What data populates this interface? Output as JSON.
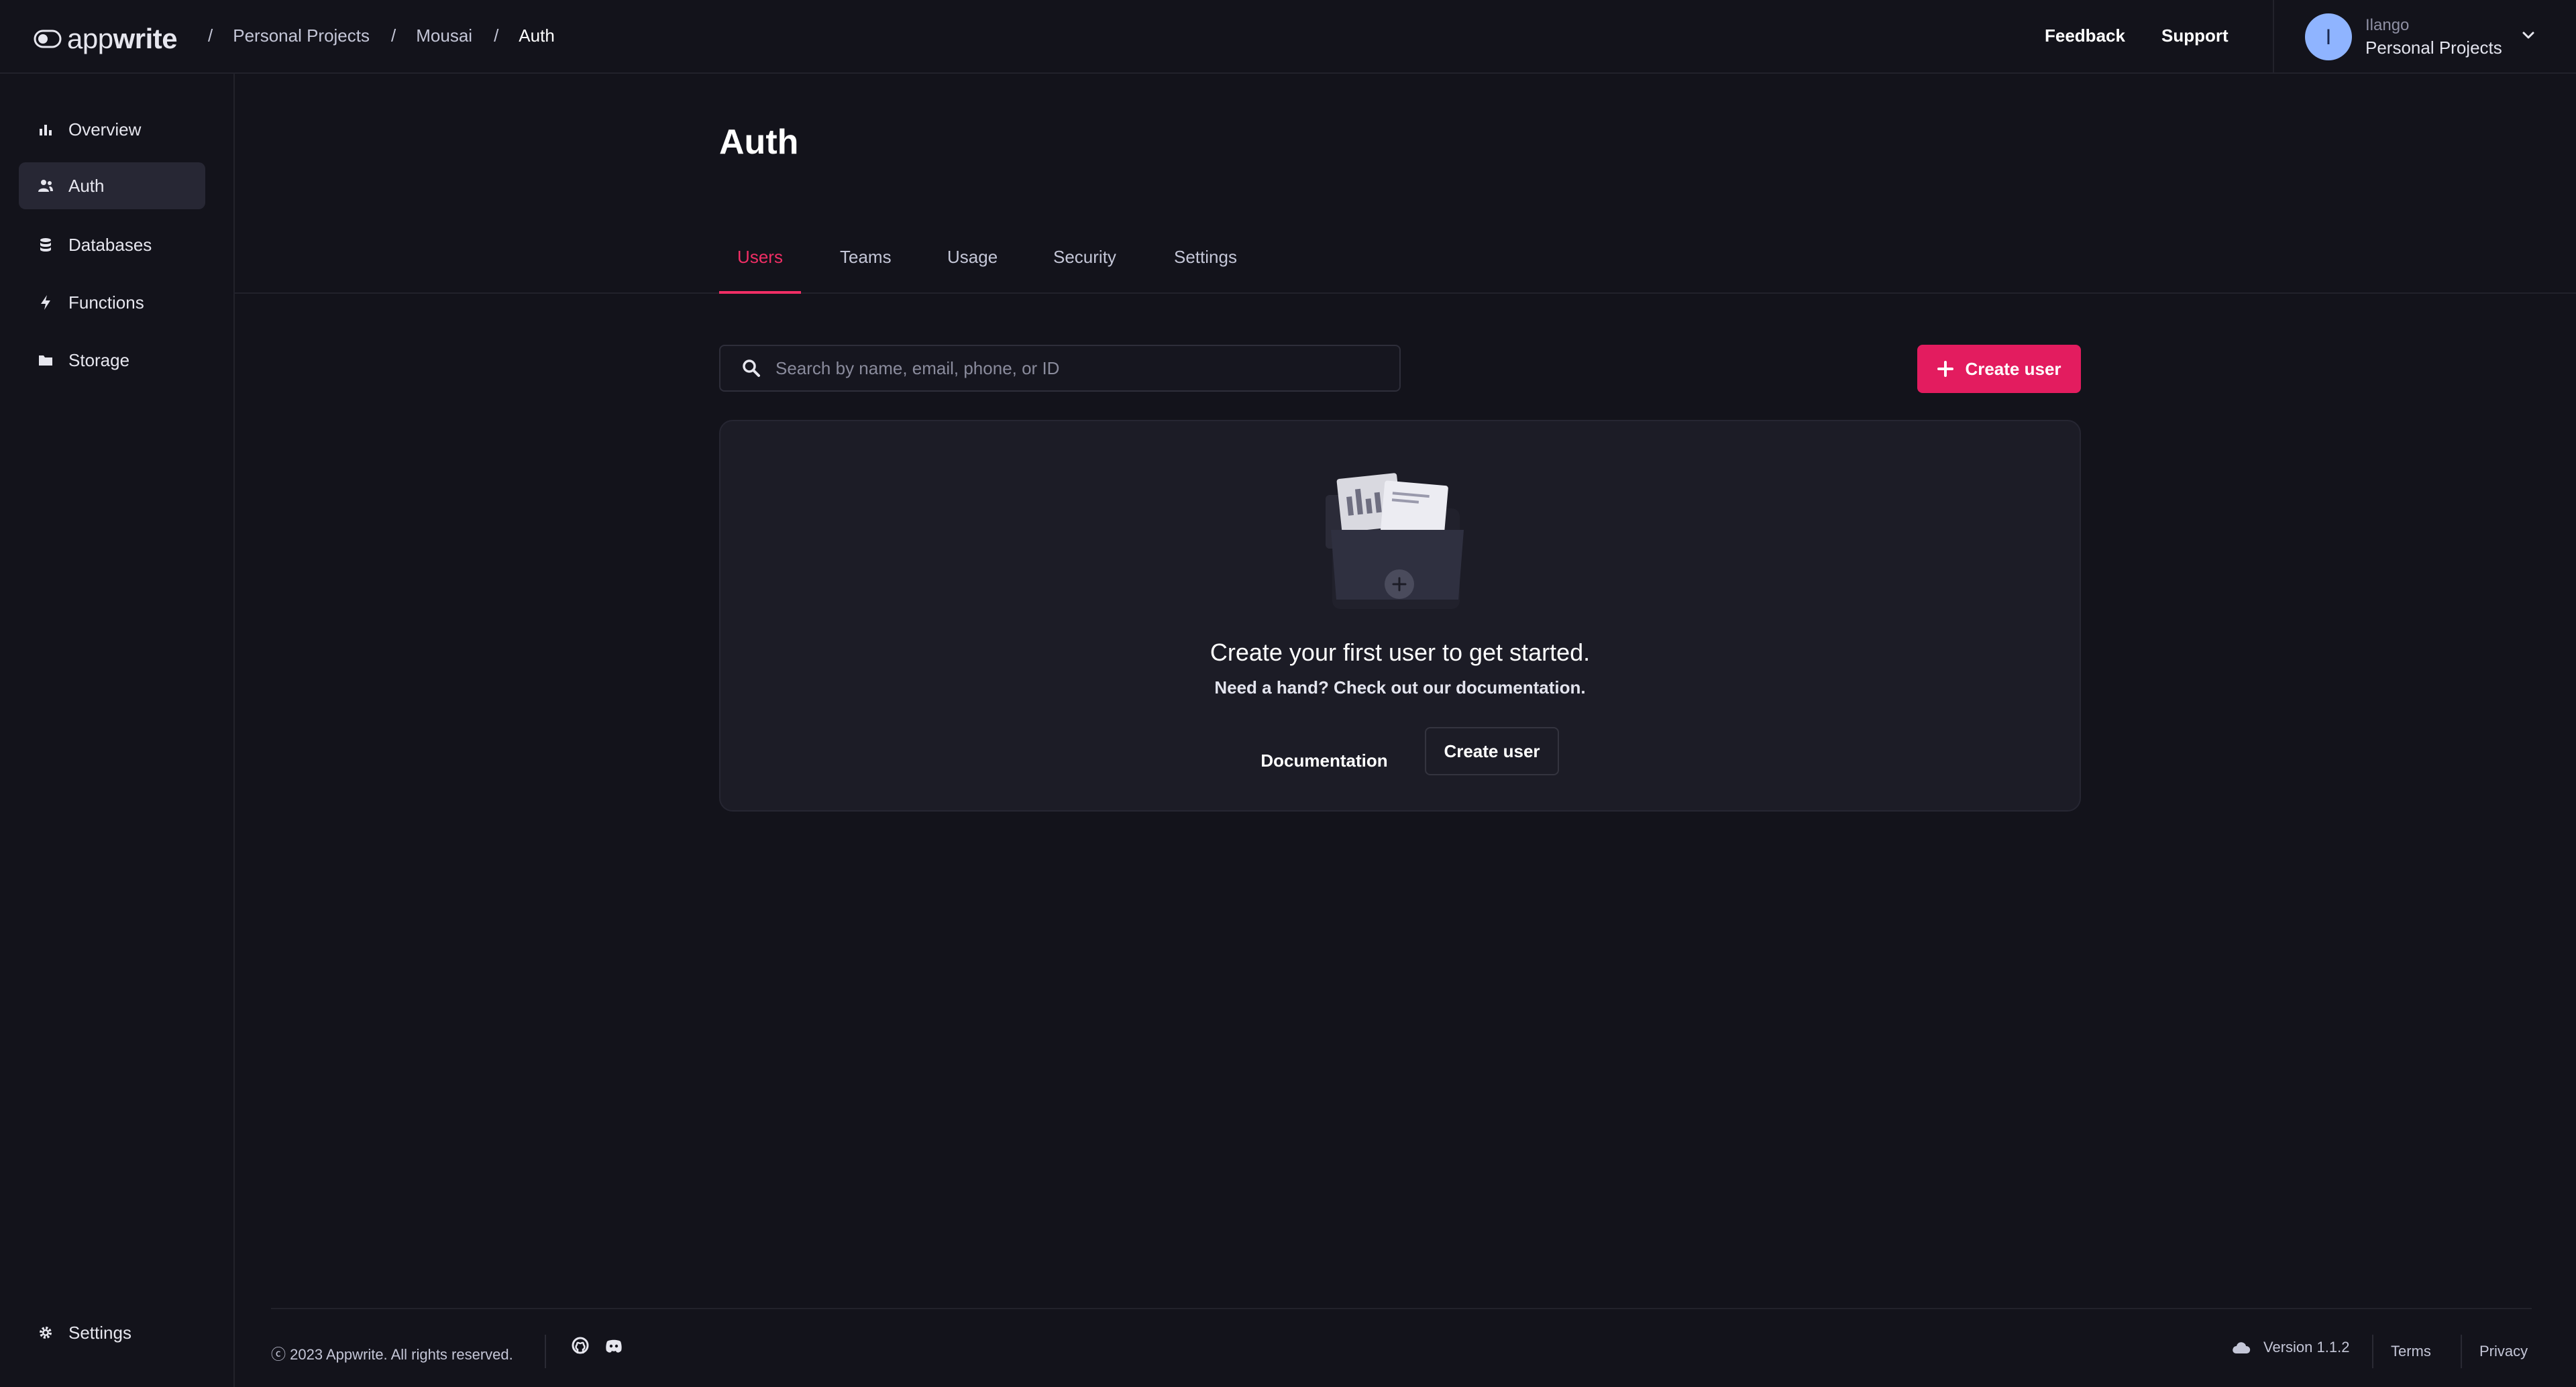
{
  "brand": {
    "logo_text_prefix": "app",
    "logo_text_suffix": "write",
    "accent_color": "#f02e65"
  },
  "breadcrumb": {
    "items": [
      "Personal Projects",
      "Mousai",
      "Auth"
    ]
  },
  "header": {
    "feedback_label": "Feedback",
    "support_label": "Support",
    "user": {
      "initial": "I",
      "name": "Ilango",
      "org": "Personal Projects"
    }
  },
  "sidebar": {
    "items": [
      {
        "label": "Overview",
        "icon": "bar-chart-icon"
      },
      {
        "label": "Auth",
        "icon": "users-icon",
        "active": true
      },
      {
        "label": "Databases",
        "icon": "database-icon"
      },
      {
        "label": "Functions",
        "icon": "lightning-icon"
      },
      {
        "label": "Storage",
        "icon": "folder-icon"
      }
    ],
    "settings_label": "Settings"
  },
  "main": {
    "title": "Auth",
    "tabs": [
      {
        "label": "Users",
        "active": true
      },
      {
        "label": "Teams"
      },
      {
        "label": "Usage"
      },
      {
        "label": "Security"
      },
      {
        "label": "Settings"
      }
    ],
    "search": {
      "placeholder": "Search by name, email, phone, or ID"
    },
    "create_user_label": "Create user",
    "empty_state": {
      "title": "Create your first user to get started.",
      "subtitle": "Need a hand? Check out our documentation.",
      "documentation_label": "Documentation",
      "create_user_label": "Create user"
    }
  },
  "footer": {
    "copyright": "2023 Appwrite. All rights reserved.",
    "version": "Version 1.1.2",
    "terms": "Terms",
    "privacy": "Privacy"
  }
}
